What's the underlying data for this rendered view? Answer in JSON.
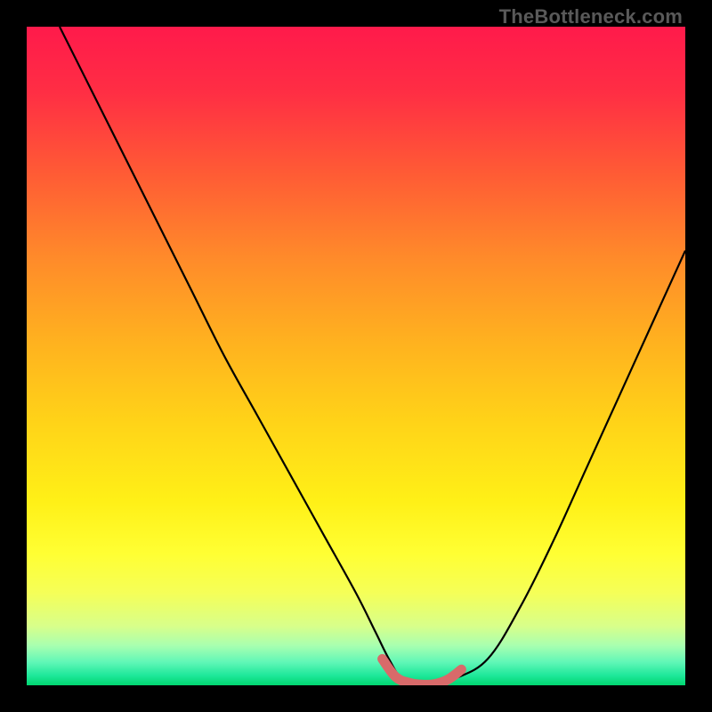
{
  "watermark": "TheBottleneck.com",
  "chart_data": {
    "type": "line",
    "title": "",
    "xlabel": "",
    "ylabel": "",
    "xlim": [
      0,
      100
    ],
    "ylim": [
      0,
      100
    ],
    "grid": false,
    "series": [
      {
        "name": "bottleneck-curve",
        "x": [
          5,
          10,
          15,
          20,
          25,
          30,
          35,
          40,
          45,
          50,
          53,
          55,
          57,
          60,
          62,
          65,
          70,
          75,
          80,
          85,
          90,
          95,
          100
        ],
        "y": [
          100,
          90,
          80,
          70,
          60,
          50,
          41,
          32,
          23,
          14,
          8,
          4,
          1,
          0,
          0,
          1,
          4,
          12,
          22,
          33,
          44,
          55,
          66
        ],
        "color": "#000000"
      },
      {
        "name": "optimal-segment",
        "x": [
          54,
          56,
          58,
          60,
          62,
          64,
          66
        ],
        "y": [
          4,
          1.3,
          0.4,
          0.1,
          0.2,
          0.9,
          2.4
        ],
        "color": "#d86a6a"
      }
    ],
    "gradient_stops": [
      {
        "pos": 0.0,
        "color": "#ff1a4b"
      },
      {
        "pos": 0.1,
        "color": "#ff2e44"
      },
      {
        "pos": 0.22,
        "color": "#ff5a35"
      },
      {
        "pos": 0.35,
        "color": "#ff8a2a"
      },
      {
        "pos": 0.48,
        "color": "#ffb21f"
      },
      {
        "pos": 0.6,
        "color": "#ffd318"
      },
      {
        "pos": 0.72,
        "color": "#fff017"
      },
      {
        "pos": 0.8,
        "color": "#ffff33"
      },
      {
        "pos": 0.86,
        "color": "#f5ff58"
      },
      {
        "pos": 0.91,
        "color": "#d8ff8a"
      },
      {
        "pos": 0.94,
        "color": "#a8ffb0"
      },
      {
        "pos": 0.965,
        "color": "#60f7b7"
      },
      {
        "pos": 0.985,
        "color": "#1ee89a"
      },
      {
        "pos": 1.0,
        "color": "#00d670"
      }
    ]
  }
}
